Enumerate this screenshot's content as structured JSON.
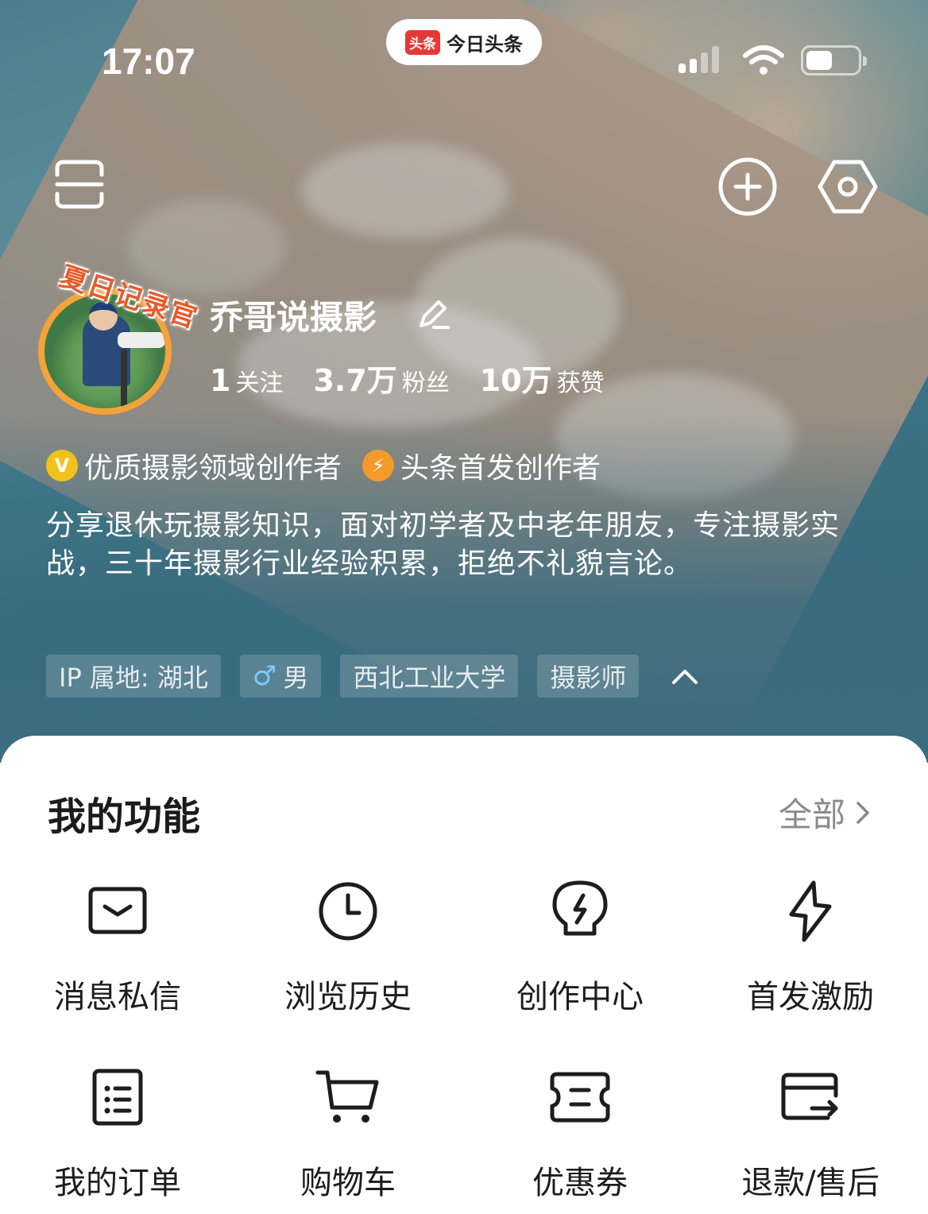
{
  "status_bar": {
    "time": "17:07",
    "app_logo": "头条",
    "app_name": "今日头条",
    "signal_icon": "cellular-signal-icon",
    "wifi_icon": "wifi-icon",
    "battery_icon": "battery-icon"
  },
  "top_actions": {
    "left_icon": "scan-icon",
    "right_icons": [
      "add-circle-icon",
      "settings-hexagon-icon"
    ]
  },
  "profile": {
    "badge_text": "夏日记录官",
    "name": "乔哥说摄影",
    "edit_icon": "pencil-icon",
    "stats": [
      {
        "value": "1",
        "label": "关注"
      },
      {
        "value": "3.7万",
        "label": "粉丝"
      },
      {
        "value": "10万",
        "label": "获赞"
      }
    ],
    "certifications": [
      {
        "icon_text": "V",
        "label": "优质摄影领域创作者",
        "color": "#f2c21b"
      },
      {
        "icon_text": "⚡",
        "label": "头条首发创作者",
        "color": "#f39a2a"
      }
    ],
    "bio": "分享退休玩摄影知识，面对初学者及中老年朋友，专注摄影实战，三十年摄影行业经验积累，拒绝不礼貌言论。",
    "tags": [
      {
        "label": "IP 属地: 湖北"
      },
      {
        "symbol": "♂",
        "label": "男"
      },
      {
        "label": "西北工业大学"
      },
      {
        "label": "摄影师"
      }
    ],
    "collapse_icon": "chevron-up-icon"
  },
  "functions": {
    "title": "我的功能",
    "all_label": "全部",
    "items": [
      {
        "label": "消息私信",
        "icon": "message-icon"
      },
      {
        "label": "浏览历史",
        "icon": "clock-icon"
      },
      {
        "label": "创作中心",
        "icon": "bulb-icon"
      },
      {
        "label": "首发激励",
        "icon": "lightning-icon"
      },
      {
        "label": "我的订单",
        "icon": "order-list-icon"
      },
      {
        "label": "购物车",
        "icon": "cart-icon"
      },
      {
        "label": "优惠券",
        "icon": "coupon-icon"
      },
      {
        "label": "退款/售后",
        "icon": "refund-card-icon"
      }
    ]
  },
  "colors": {
    "hero_sea": "#3b6c7f",
    "sand": "#a89585",
    "badge_orange": "#e85a2a",
    "gender_blue": "#7cc8ff"
  }
}
